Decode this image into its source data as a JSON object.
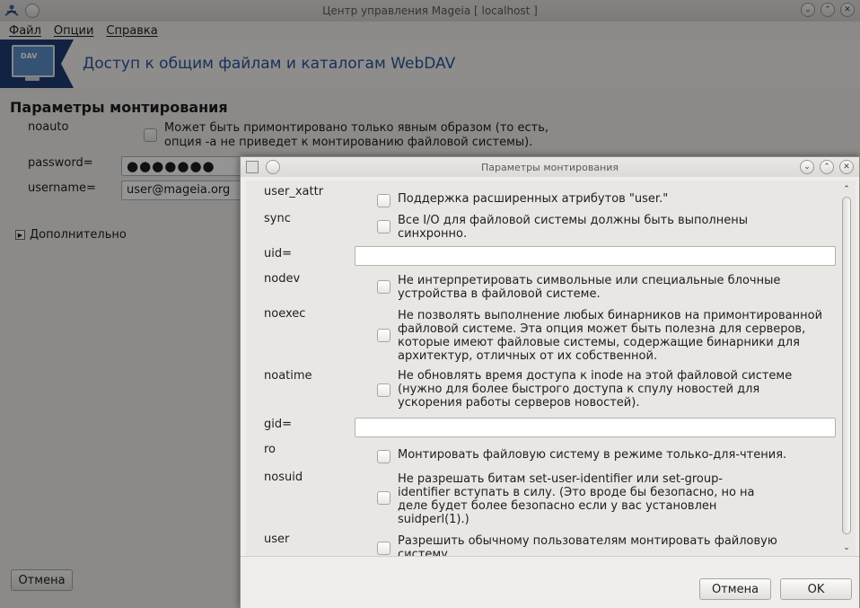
{
  "window": {
    "title": "Центр управления Mageia  [ localhost ]"
  },
  "menu": {
    "items": [
      "Файл",
      "Опции",
      "Справка"
    ]
  },
  "banner": {
    "icon_label": "DAV",
    "title": "Доступ к общим файлам и каталогам WebDAV"
  },
  "main": {
    "section_title": "Параметры монтирования",
    "noauto_label": "noauto",
    "noauto_desc_1": "Может быть примонтировано только явным образом (то есть,",
    "noauto_desc_2": "опция -a не приведет к монтированию файловой системы).",
    "password_label": "password=",
    "password_value": "●●●●●●●",
    "username_label": "username=",
    "username_value": "user@mageia.org",
    "advanced_label": "Дополнительно",
    "cancel_button": "Отмена"
  },
  "dialog": {
    "title": "Параметры монтирования",
    "options": [
      {
        "name": "user_xattr",
        "desc": "Поддержка расширенных атрибутов \"user.\""
      },
      {
        "name": "sync",
        "desc": "Все I/O для файловой системы должны быть выполнены синхронно."
      },
      {
        "name": "uid=",
        "desc": ""
      },
      {
        "name": "nodev",
        "desc": "Не интерпретировать символьные или специальные блочные устройства в файловой системе."
      },
      {
        "name": "noexec",
        "desc": "Не позволять выполнение любых бинарников на примонтированной файловой системе. Эта опция может быть полезна для серверов, которые имеют файловые системы, содержащие бинарники для архитектур, отличных от их собственной."
      },
      {
        "name": "noatime",
        "desc": "Не обновлять время доступа к inode на этой файловой системе (нужно для более быстрого доступа к спулу новостей для ускорения работы серверов новостей)."
      },
      {
        "name": "gid=",
        "desc": ""
      },
      {
        "name": "ro",
        "desc": "Монтировать файловую систему в режиме только-для-чтения."
      },
      {
        "name": "nosuid",
        "desc": "Не разрешать битам set-user-identifier или set-group-identifier вступать в силу. (Это вроде бы безопасно, но на деле будет более безопасно если у вас установлен suidperl(1).)"
      },
      {
        "name": "user",
        "desc": "Разрешить обычному пользователям монтировать файловую систему."
      }
    ],
    "cancel_button": "Отмена",
    "ok_button": "OK"
  }
}
